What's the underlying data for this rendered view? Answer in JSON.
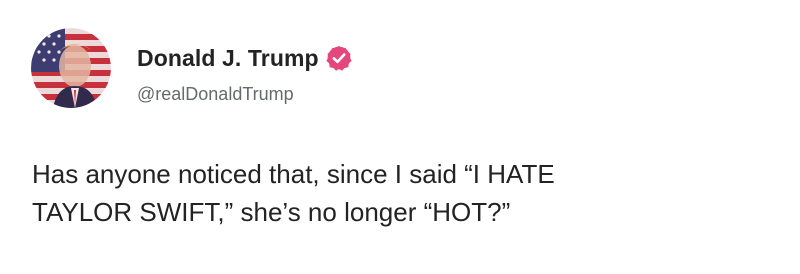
{
  "post": {
    "author": {
      "display_name": "Donald J. Trump",
      "handle": "@realDonaldTrump",
      "avatar_icon": "american-flag-portrait-avatar",
      "verified_icon": "verified-badge-icon",
      "verified_color": "#e5467b"
    },
    "text_lines": [
      "Has anyone noticed that, since I said “I HATE",
      "TAYLOR SWIFT,” she’s no longer “HOT?”"
    ]
  }
}
